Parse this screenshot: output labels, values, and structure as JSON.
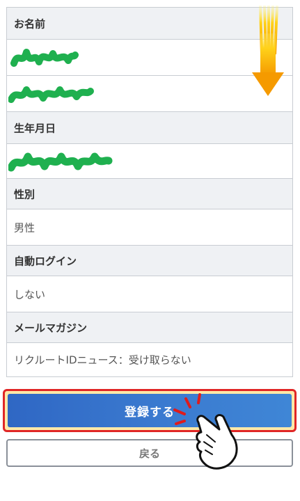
{
  "fields": [
    {
      "label": "お名前",
      "values": [
        "",
        ""
      ]
    },
    {
      "label": "生年月日",
      "value": ""
    },
    {
      "label": "性別",
      "value": "男性"
    },
    {
      "label": "自動ログイン",
      "value": "しない"
    },
    {
      "label": "メールマガジン",
      "value": "リクルートIDニュース：受け取らない"
    }
  ],
  "actions": {
    "register_label": "登録する",
    "back_label": "戻る"
  },
  "colors": {
    "primary_button": "#3a79cf",
    "highlight_border": "#e02626",
    "redaction": "#1fb04f",
    "arrow": "#f7a800"
  },
  "icons": [
    "down-arrow-icon",
    "pointing-hand-icon"
  ]
}
